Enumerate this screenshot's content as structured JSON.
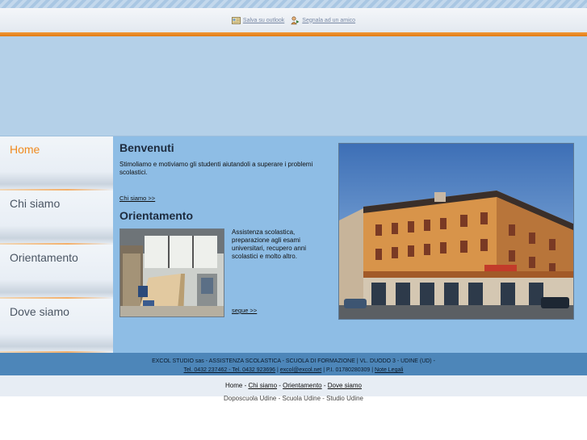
{
  "toolbar": {
    "save_label": "Salva su outlook",
    "save_icon": "outlook-card-icon",
    "share_label": "Segnala ad un amico",
    "share_icon": "person-share-icon"
  },
  "nav": {
    "items": [
      {
        "label": "Home",
        "active": true
      },
      {
        "label": "Chi siamo",
        "active": false
      },
      {
        "label": "Orientamento",
        "active": false
      },
      {
        "label": "Dove siamo",
        "active": false
      }
    ]
  },
  "main": {
    "welcome_title": "Benvenuti",
    "welcome_text": "Stimoliamo e motiviamo gli studenti aiutandoli a superare i problemi scolastici.",
    "welcome_link": "Chi siamo >>",
    "orient_title": "Orientamento",
    "orient_text": "Assistenza scolastica, preparazione agli esami universitari, recupero anni scolastici e molto altro.",
    "orient_link": "segue >>"
  },
  "footer": {
    "line1": "EXCOL STUDIO sas - ASSISTENZA SCOLASTICA - SCUOLA DI FORMAZIONE | VL. DUODO 3 - UDINE (UD) -",
    "phone": "Tel. 0432 237462 - Tel. 0432 923696",
    "sep1": " | ",
    "email": "excol@excol.net",
    "piva": " | P.I. 01780280309 | ",
    "legal": "Note Legali",
    "links": [
      {
        "label": "Home",
        "linked": false
      },
      {
        "label": "Chi siamo",
        "linked": true
      },
      {
        "label": "Orientamento",
        "linked": true
      },
      {
        "label": "Dove siamo",
        "linked": true
      }
    ],
    "link_sep": " - ",
    "cut_line": "Doposcuola Udine - Scuola Udine - Studio Udine"
  },
  "colors": {
    "accent": "#f08a1e",
    "content_bg": "#8ebde5",
    "footer_bg": "#4d86b9"
  }
}
